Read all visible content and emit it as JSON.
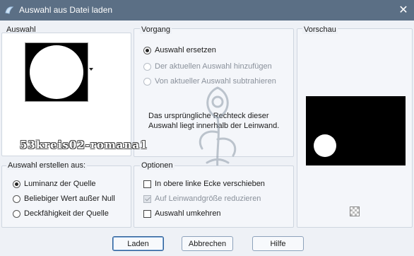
{
  "window": {
    "title": "Auswahl aus Datei laden",
    "close_glyph": "✕",
    "app_icon": "psp-icon"
  },
  "auswahl": {
    "label": "Auswahl"
  },
  "vorgang": {
    "label": "Vorgang",
    "options": [
      {
        "label": "Auswahl ersetzen",
        "selected": true,
        "enabled": true
      },
      {
        "label": "Der aktuellen Auswahl hinzufügen",
        "selected": false,
        "enabled": false
      },
      {
        "label": "Von aktueller Auswahl subtrahieren",
        "selected": false,
        "enabled": false
      }
    ],
    "info": "Das ursprüngliche Rechteck dieser Auswahl liegt innerhalb der Leinwand."
  },
  "vorschau": {
    "label": "Vorschau"
  },
  "erstellen": {
    "label": "Auswahl erstellen aus:",
    "options": [
      {
        "label": "Luminanz der Quelle",
        "selected": true
      },
      {
        "label": "Beliebiger Wert außer Null",
        "selected": false
      },
      {
        "label": "Deckfähigkeit der Quelle",
        "selected": false
      }
    ]
  },
  "optionen": {
    "label": "Optionen",
    "options": [
      {
        "label": "In obere linke Ecke verschieben",
        "checked": false,
        "enabled": true
      },
      {
        "label": "Auf Leinwandgröße reduzieren",
        "checked": true,
        "enabled": false
      },
      {
        "label": "Auswahl umkehren",
        "checked": false,
        "enabled": true
      }
    ]
  },
  "watermark": {
    "text": "53kreis02-romana1"
  },
  "buttons": {
    "load": "Laden",
    "cancel": "Abbrechen",
    "help": "Hilfe"
  },
  "colors": {
    "titlebar": "#5b6f85",
    "background": "#eef1f6",
    "accent": "#2f5f96"
  }
}
